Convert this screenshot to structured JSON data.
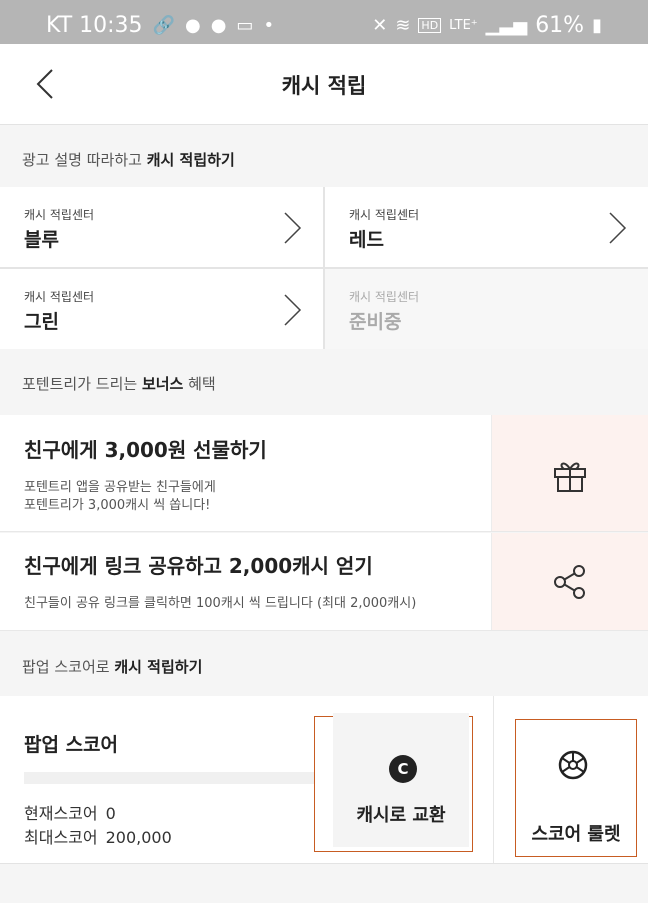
{
  "status_bar": {
    "carrier_time": "KT 10:35",
    "battery": "61%",
    "network": "LTE⁺",
    "hd": "HD"
  },
  "header": {
    "title": "캐시 적립"
  },
  "section1": {
    "prefix": "광고 설명 따라하고 ",
    "bold": "캐시 적립하기"
  },
  "centers": [
    {
      "sub": "캐시 적립센터",
      "name": "블루"
    },
    {
      "sub": "캐시 적립센터",
      "name": "레드"
    },
    {
      "sub": "캐시 적립센터",
      "name": "그린"
    },
    {
      "sub": "캐시 적립센터",
      "name": "준비중"
    }
  ],
  "section2": {
    "prefix": "포텐트리가 드리는 ",
    "bold": "보너스",
    "suffix": " 혜택"
  },
  "bonus": [
    {
      "title": "친구에게 3,000원 선물하기",
      "desc_line1": "포텐트리 앱을 공유받는 친구들에게",
      "desc_line2": "포텐트리가 3,000캐시 씩 쏩니다!",
      "icon": "gift-icon"
    },
    {
      "title": "친구에게 링크 공유하고 2,000캐시 얻기",
      "desc_line1": "친구들이 공유 링크를 클릭하면 100캐시 씩 드립니다 (최대 2,000캐시)",
      "icon": "share-icon"
    }
  ],
  "section3": {
    "prefix": "팝업 스코어로 ",
    "bold": "캐시 적립하기"
  },
  "popup": {
    "title": "팝업 스코어",
    "current_label": "현재스코어",
    "current_value": "0",
    "max_label": "최대스코어",
    "max_value": "200,000",
    "exchange_label": "캐시로 교환",
    "coin_symbol": "C",
    "roulette_label": "스코어 룰렛"
  },
  "colors": {
    "accent_border": "#c75c22",
    "bonus_side_bg": "#fdf2ef"
  }
}
